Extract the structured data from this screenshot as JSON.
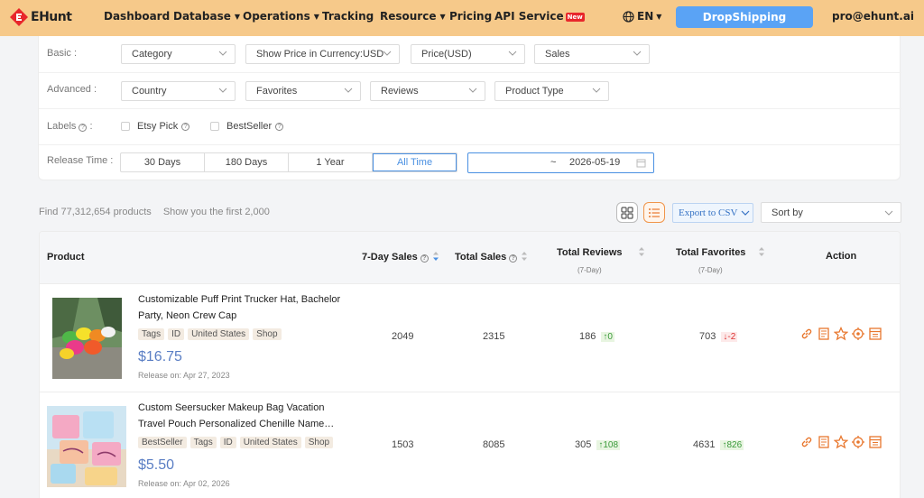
{
  "nav": {
    "logo": "EHunt",
    "items": [
      {
        "label": "Dashboard",
        "dropdown": false
      },
      {
        "label": "Database",
        "dropdown": true
      },
      {
        "label": "Operations",
        "dropdown": true
      },
      {
        "label": "Tracking",
        "dropdown": false
      },
      {
        "label": "Resource",
        "dropdown": true
      },
      {
        "label": "Pricing",
        "dropdown": false
      },
      {
        "label": "API Service",
        "dropdown": false,
        "badge": "New"
      }
    ],
    "language": "EN",
    "cta": "DropShipping",
    "user_email": "pro@ehunt.ai",
    "bar_color": "#f6c98a",
    "cta_color": "#5aa3f5"
  },
  "filters": {
    "basic_label": "Basic :",
    "basic": [
      "Category",
      "Show Price in Currency:USD",
      "Price(USD)",
      "Sales"
    ],
    "advanced_label": "Advanced :",
    "advanced": [
      "Country",
      "Favorites",
      "Reviews",
      "Product Type"
    ],
    "labels_label": "Labels",
    "labels_suffix": ":",
    "labels": [
      "Etsy Pick",
      "BestSeller"
    ],
    "release_label": "Release Time :",
    "release_options": [
      "30 Days",
      "180 Days",
      "1 Year",
      "All Time"
    ],
    "release_active": "All Time",
    "date_separator": "~",
    "date_end": "2026-05-19"
  },
  "summary": {
    "found": "Find 77,312,654 products",
    "shown": "Show you the first 2,000"
  },
  "toolbar": {
    "export_label": "Export to CSV",
    "sort_placeholder": "Sort by"
  },
  "table": {
    "headers": {
      "product": "Product",
      "sales7": "7-Day Sales",
      "total_sales": "Total Sales",
      "total_reviews": "Total Reviews",
      "total_reviews_sub": "(7-Day)",
      "total_favorites": "Total Favorites",
      "total_favorites_sub": "(7-Day)",
      "action": "Action"
    },
    "rows": [
      {
        "title_line1": "Customizable Puff Print Trucker Hat, Bachelor",
        "title_line2": "Party, Neon Crew Cap",
        "tags": [
          "Tags",
          "ID",
          "United States",
          "Shop"
        ],
        "price": "$16.75",
        "release": "Release on: Apr 27, 2023",
        "sales7": "2049",
        "total_sales": "2315",
        "reviews": "186",
        "reviews_delta": "↑0",
        "reviews_trend": "up",
        "favorites": "703",
        "favorites_delta": "↓-2",
        "favorites_trend": "down"
      },
      {
        "title_line1": "Custom Seersucker Makeup Bag Vacation",
        "title_line2": "Travel Pouch Personalized Chenille Name…",
        "tags": [
          "BestSeller",
          "Tags",
          "ID",
          "United States",
          "Shop"
        ],
        "price": "$5.50",
        "release": "Release on: Apr 02, 2026",
        "sales7": "1503",
        "total_sales": "8085",
        "reviews": "305",
        "reviews_delta": "↑108",
        "reviews_trend": "up",
        "favorites": "4631",
        "favorites_delta": "↑826",
        "favorites_trend": "up"
      }
    ],
    "action_icons": [
      "link-icon",
      "detail-icon",
      "star-icon",
      "track-icon",
      "calendar-icon"
    ],
    "accent_color": "#e8772e"
  }
}
